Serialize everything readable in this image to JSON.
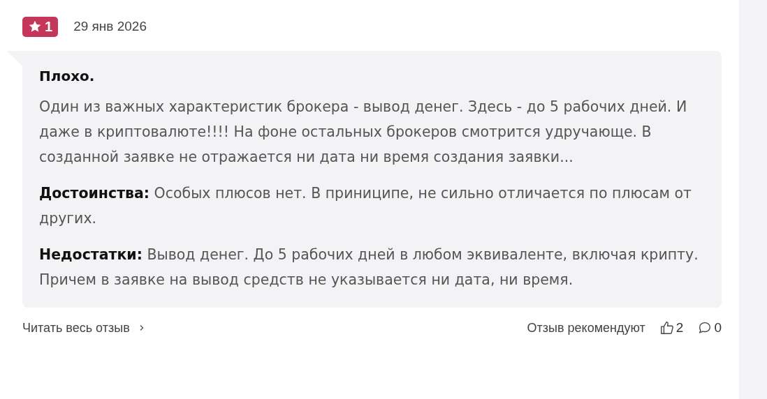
{
  "review": {
    "rating": "1",
    "date": "29 янв 2026",
    "title": "Плохо.",
    "body": "Один из важных характеристик брокера - вывод денег. Здесь - до 5 рабочих дней. И даже в криптовалюте!!!! На фоне остальных брокеров смотрится удручающе. В созданной заявке не отражается ни дата ни время создания заявки...",
    "sections": [
      "**Достоинства:** Особых плюсов нет. В приниципе, не сильно отличается по плюсам от других.",
      "**Недостатки:** Вывод денег. До 5 рабочих дней в любом эквиваленте, включая крипту. Причем в заявке на вывод средств не указывается ни дата, ни время."
    ]
  },
  "footer": {
    "read_more": "Читать весь отзыв",
    "recommend_label": "Отзыв рекомендуют",
    "likes": "2",
    "comments": "0"
  }
}
